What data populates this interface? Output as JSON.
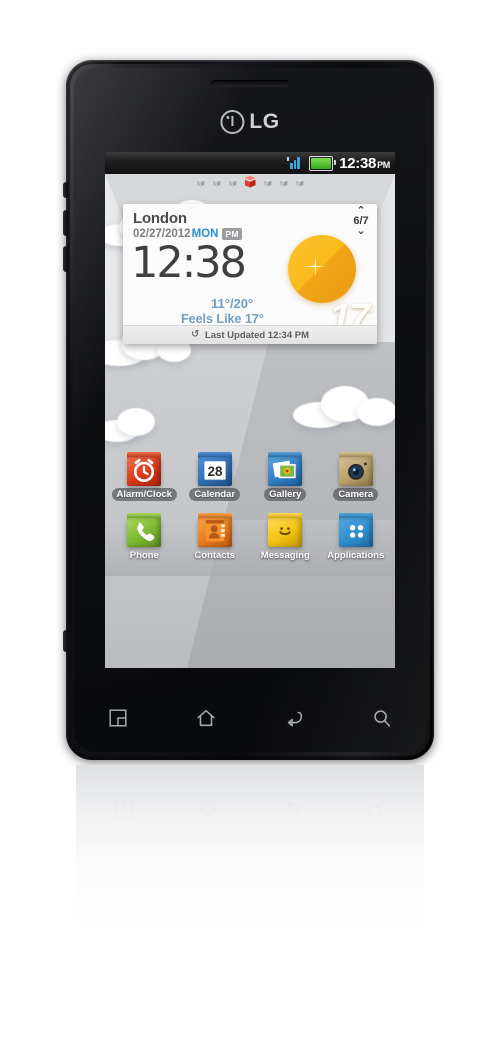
{
  "device": {
    "brand_logo": "LG",
    "logo_mark": "lg-face-logo"
  },
  "statusbar": {
    "signal_icon": "signal-bars-icon",
    "battery_icon": "battery-full-icon",
    "time": "12:38",
    "meridiem": "PM"
  },
  "homescreen": {
    "page_indicator": {
      "total": 7,
      "active_index": 3,
      "icon": "cube-icon"
    }
  },
  "widget": {
    "name": "weather-clock-widget",
    "city": "London",
    "date": "02/27/2012",
    "weekday": "MON",
    "meridiem": "PM",
    "time": "12:38",
    "high_low": "11°/20°",
    "feels_like_label": "Feels Like",
    "feels_like": "17°",
    "current_temp": "17",
    "degree": "°",
    "condition_icon": "sunny-icon",
    "pager": "6/7",
    "chevron_up": "⌃",
    "chevron_down": "⌄",
    "last_updated": "Last Updated 12:34 PM",
    "refresh_icon": "refresh-icon"
  },
  "apps": {
    "row1": [
      {
        "label": "Alarm/Clock",
        "icon": "alarm-clock-icon",
        "color": "#e04a28"
      },
      {
        "label": "Calendar",
        "icon": "calendar-icon",
        "color": "#2d72b8",
        "day": "28"
      },
      {
        "label": "Gallery",
        "icon": "gallery-icon",
        "color": "#2f7fc4"
      },
      {
        "label": "Camera",
        "icon": "camera-icon",
        "color": "#b9a06a"
      }
    ],
    "row2": [
      {
        "label": "Phone",
        "icon": "phone-icon",
        "color": "#8cc63f"
      },
      {
        "label": "Contacts",
        "icon": "contacts-icon",
        "color": "#f07d1e"
      },
      {
        "label": "Messaging",
        "icon": "messaging-icon",
        "color": "#f5c518"
      },
      {
        "label": "Applications",
        "icon": "applications-icon",
        "color": "#2f8fd0"
      }
    ]
  },
  "navbar": [
    {
      "name": "menu-icon",
      "label": "Menu"
    },
    {
      "name": "home-icon",
      "label": "Home"
    },
    {
      "name": "back-icon",
      "label": "Back"
    },
    {
      "name": "search-icon",
      "label": "Search"
    }
  ],
  "colors": {
    "accent_blue": "#2b8ddb",
    "sun_yellow": "#f9b919",
    "ray_orange": "#f08a2a",
    "battery_green": "#35a81a",
    "signal_blue": "#3aa6e0",
    "active_cube_red": "#e8392c"
  }
}
